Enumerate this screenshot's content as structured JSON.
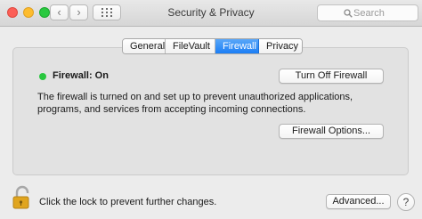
{
  "window": {
    "title": "Security & Privacy",
    "nav": {
      "back": "‹",
      "forward": "›"
    }
  },
  "search": {
    "placeholder": "Search"
  },
  "tabs": [
    {
      "label": "General",
      "active": false
    },
    {
      "label": "FileVault",
      "active": false
    },
    {
      "label": "Firewall",
      "active": true
    },
    {
      "label": "Privacy",
      "active": false
    }
  ],
  "firewall": {
    "status": "Firewall: On",
    "status_color": "#29c73f",
    "turn_off_label": "Turn Off Firewall",
    "description": "The firewall is turned on and set up to prevent unauthorized applications, programs, and services from accepting incoming connections.",
    "options_label": "Firewall Options..."
  },
  "footer": {
    "lock_text": "Click the lock to prevent further changes.",
    "advanced_label": "Advanced...",
    "help_label": "?"
  },
  "colors": {
    "accent": "#1b7ef5",
    "close": "#fc5f57",
    "minimize": "#fdbc2e",
    "zoom": "#2ac940",
    "lock": "#e0a51f"
  },
  "icons": [
    "close-icon",
    "minimize-icon",
    "zoom-icon",
    "back-icon",
    "forward-icon",
    "grid-icon",
    "search-icon",
    "lock-icon",
    "status-dot-icon",
    "help-icon"
  ]
}
